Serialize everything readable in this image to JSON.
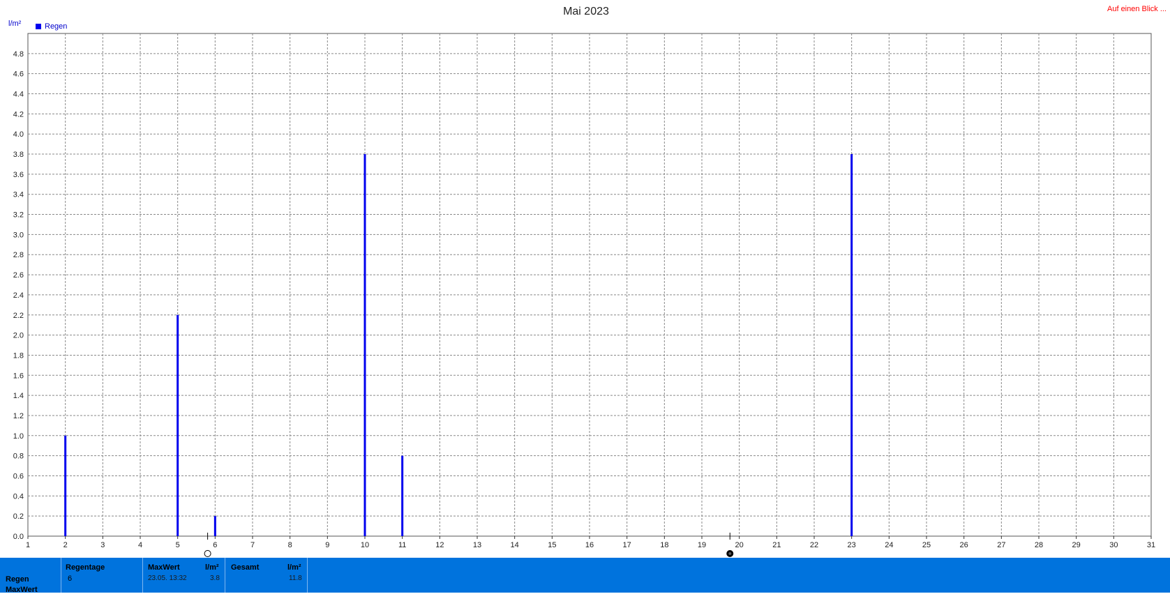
{
  "page": {
    "title": "Mai 2023",
    "link_text": "Auf einen Blick ...",
    "colors": {
      "series": "#0000ee",
      "link": "#ff0000",
      "footer_bg": "#0073dd",
      "grid": "#888888"
    }
  },
  "chart_data": {
    "type": "bar",
    "title": "Mai 2023",
    "ylabel": "l/m²",
    "xlabel": "",
    "x_ticks": [
      1,
      2,
      3,
      4,
      5,
      6,
      7,
      8,
      9,
      10,
      11,
      12,
      13,
      14,
      15,
      16,
      17,
      18,
      19,
      20,
      21,
      22,
      23,
      24,
      25,
      26,
      27,
      28,
      29,
      30,
      31
    ],
    "y_ticks": [
      "0.0",
      "0.2",
      "0.4",
      "0.6",
      "0.8",
      "1.0",
      "1.2",
      "1.4",
      "1.6",
      "1.8",
      "2.0",
      "2.2",
      "2.4",
      "2.6",
      "2.8",
      "3.0",
      "3.2",
      "3.4",
      "3.6",
      "3.8",
      "4.0",
      "4.2",
      "4.4",
      "4.6",
      "4.8"
    ],
    "xlim": [
      1,
      31
    ],
    "ylim": [
      0,
      5.0
    ],
    "grid": true,
    "legend_position": "top-left",
    "series": [
      {
        "name": "Regen",
        "color": "#0000ee",
        "x": [
          2,
          5,
          6,
          10,
          11,
          23
        ],
        "values": [
          1.0,
          2.2,
          0.2,
          3.8,
          0.8,
          3.8
        ]
      }
    ],
    "moon_markers": [
      {
        "x": 5.8,
        "icon": "new-moon-icon"
      },
      {
        "x": 19.75,
        "icon": "full-moon-icon"
      }
    ]
  },
  "footer": {
    "row_labels": [
      "Regen",
      "MaxWert"
    ],
    "regentage": {
      "label": "Regentage",
      "value": "6"
    },
    "maxwert": {
      "label": "MaxWert",
      "unit": "l/m²",
      "datetime": "23.05.  13:32",
      "value": "3.8"
    },
    "gesamt": {
      "label": "Gesamt",
      "unit": "l/m²",
      "value": "11.8"
    }
  }
}
